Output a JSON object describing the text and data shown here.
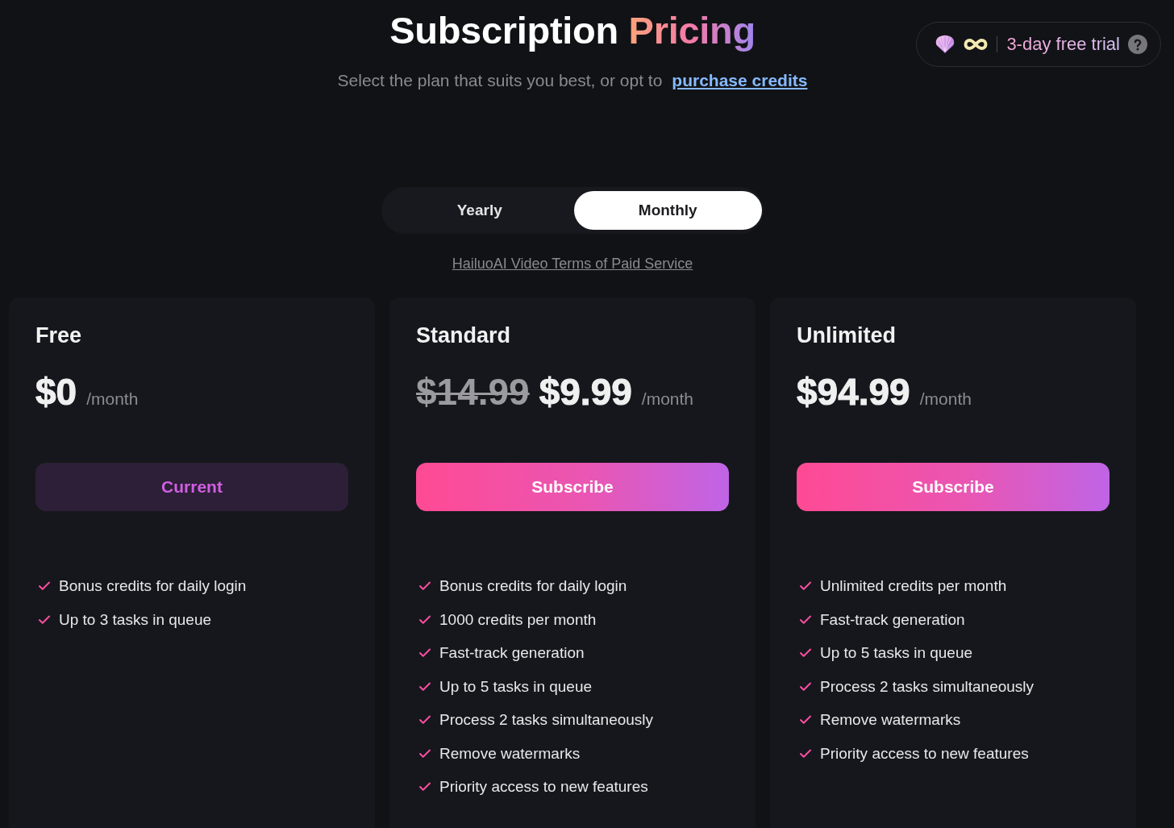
{
  "header": {
    "title": "Subscription",
    "title_accent": "Pricing",
    "subtitle": "Select the plan that suits you best, or opt to",
    "subtitle_link": "purchase credits"
  },
  "trial_badge": {
    "label": "3-day free trial"
  },
  "billing_tabs": [
    {
      "label": "Yearly",
      "selected": false
    },
    {
      "label": "Monthly",
      "selected": true
    }
  ],
  "terms_link": "HailuoAI Video Terms of Paid Service",
  "plans": [
    {
      "name": "Free",
      "price": "$0",
      "period": "/month",
      "current": true,
      "button": "Current",
      "features": [
        "Bonus credits for daily login",
        "Up to 3 tasks in queue"
      ]
    },
    {
      "name": "Standard",
      "original_price": "$14.99",
      "price": "$9.99",
      "period": "/month",
      "current": false,
      "button": "Subscribe",
      "features": [
        "Bonus credits for daily login",
        "1000 credits per month",
        "Fast-track generation",
        "Up to 5 tasks in queue",
        "Process 2 tasks simultaneously",
        "Remove watermarks",
        "Priority access to new features"
      ]
    },
    {
      "name": "Unlimited",
      "price": "$94.99",
      "period": "/month",
      "current": false,
      "button": "Subscribe",
      "features": [
        "Unlimited credits per month",
        "Fast-track generation",
        "Up to 5 tasks in queue",
        "Process 2 tasks simultaneously",
        "Remove watermarks",
        "Priority access to new features"
      ]
    }
  ]
}
